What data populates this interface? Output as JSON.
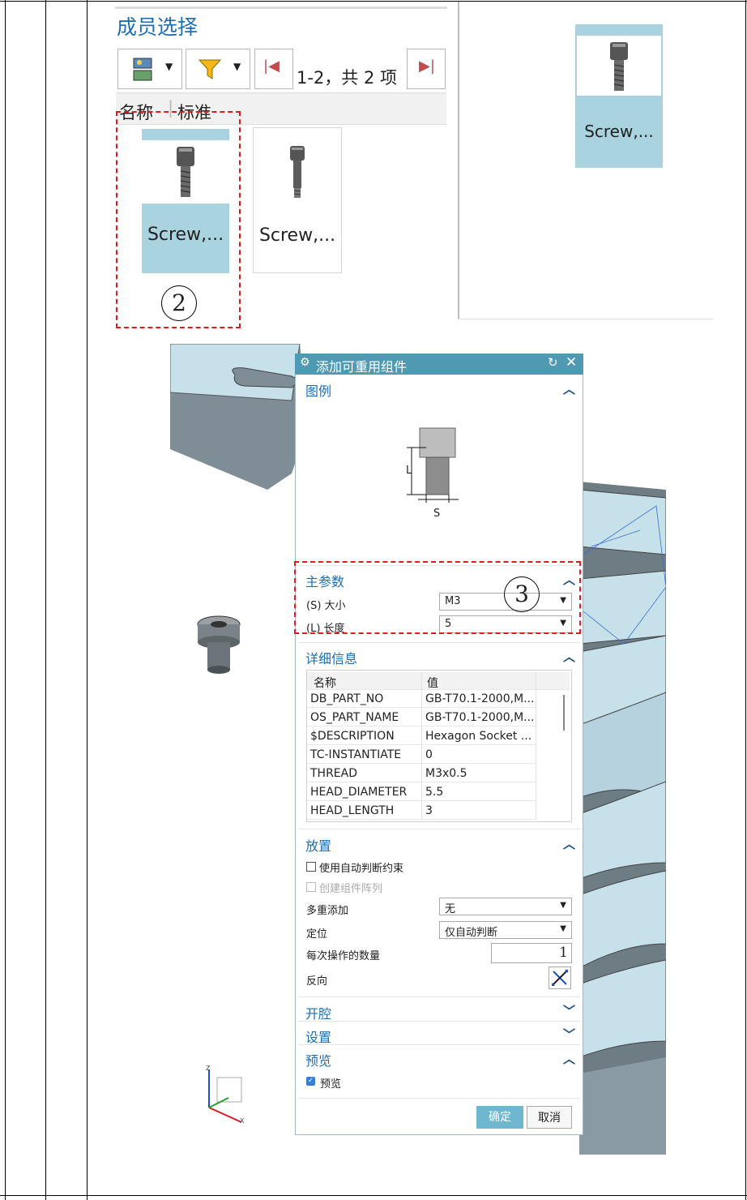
{
  "member_select": {
    "title": "成员选择",
    "paging": "1-2，共 2 项",
    "col_name": "名称",
    "col_standard": "标准",
    "items": [
      {
        "label": "Screw,..."
      },
      {
        "label": "Screw,..."
      }
    ],
    "preview_label": "Screw,...",
    "step_marker": "2"
  },
  "dialog": {
    "title": "添加可重用组件",
    "legend": {
      "heading": "图例",
      "dim_l": "L",
      "dim_s": "S"
    },
    "main_params": {
      "heading": "主参数",
      "size_label": "(S) 大小",
      "size_value": "M3",
      "length_label": "(L) 长度",
      "length_value": "5",
      "step_marker": "3"
    },
    "details": {
      "heading": "详细信息",
      "col_name": "名称",
      "col_value": "值",
      "rows": [
        {
          "name": "DB_PART_NO",
          "value": "GB-T70.1-2000,M..."
        },
        {
          "name": "OS_PART_NAME",
          "value": "GB-T70.1-2000,M..."
        },
        {
          "name": "$DESCRIPTION",
          "value": "Hexagon Socket ..."
        },
        {
          "name": "TC-INSTANTIATE",
          "value": "0"
        },
        {
          "name": "THREAD",
          "value": "M3x0.5"
        },
        {
          "name": "HEAD_DIAMETER",
          "value": "5.5"
        },
        {
          "name": "HEAD_LENGTH",
          "value": "3"
        }
      ]
    },
    "placement": {
      "heading": "放置",
      "auto_constraint": "使用自动判断约束",
      "create_array": "创建组件阵列",
      "multi_add_label": "多重添加",
      "multi_add_value": "无",
      "position_label": "定位",
      "position_value": "仅自动判断",
      "count_label": "每次操作的数量",
      "count_value": "1",
      "reverse_label": "反向"
    },
    "cavity": {
      "heading": "开腔"
    },
    "settings": {
      "heading": "设置"
    },
    "preview": {
      "heading": "预览",
      "checkbox_label": "预览"
    },
    "ok_label": "确定",
    "cancel_label": "取消"
  },
  "triad": {
    "z": "Z",
    "x": "X"
  },
  "colors": {
    "accent": "#4f9ab2",
    "selected_card": "#a9d3de",
    "link_blue": "#1b6fb3",
    "marker_red": "#e01b1b",
    "cad_model": "#bfdbe6"
  }
}
